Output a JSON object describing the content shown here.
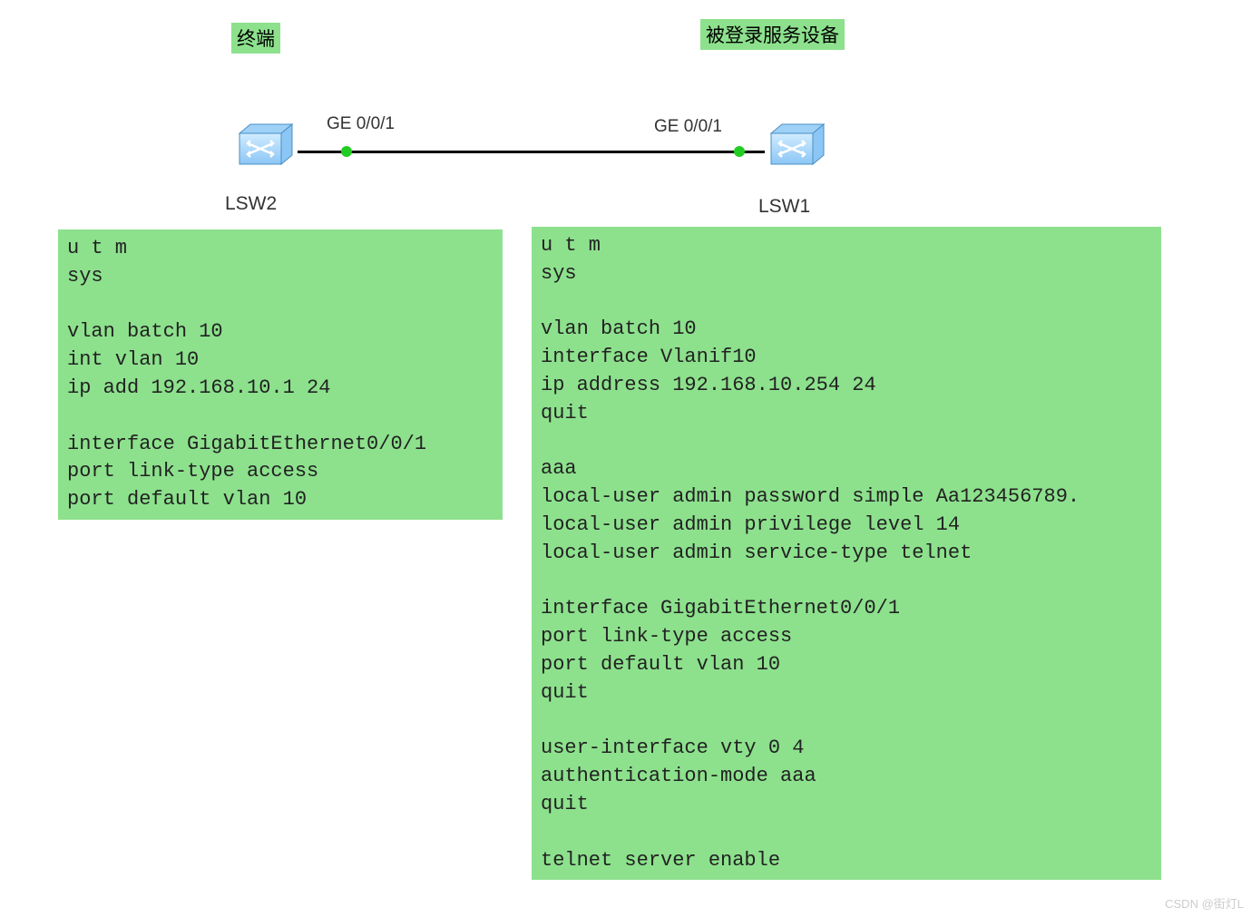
{
  "labels": {
    "terminal": "终端",
    "server": "被登录服务设备"
  },
  "ports": {
    "left": "GE 0/0/1",
    "right": "GE 0/0/1"
  },
  "devices": {
    "left": "LSW2",
    "right": "LSW1"
  },
  "code": {
    "left": "u t m\nsys\n\nvlan batch 10\nint vlan 10\nip add 192.168.10.1 24\n\ninterface GigabitEthernet0/0/1\nport link-type access\nport default vlan 10",
    "right": "u t m\nsys\n\nvlan batch 10\ninterface Vlanif10\nip address 192.168.10.254 24\nquit\n\naaa\nlocal-user admin password simple Aa123456789.\nlocal-user admin privilege level 14\nlocal-user admin service-type telnet\n\ninterface GigabitEthernet0/0/1\nport link-type access\nport default vlan 10\nquit\n\nuser-interface vty 0 4\nauthentication-mode aaa\nquit\n\ntelnet server enable"
  },
  "watermark": "CSDN @街灯L"
}
